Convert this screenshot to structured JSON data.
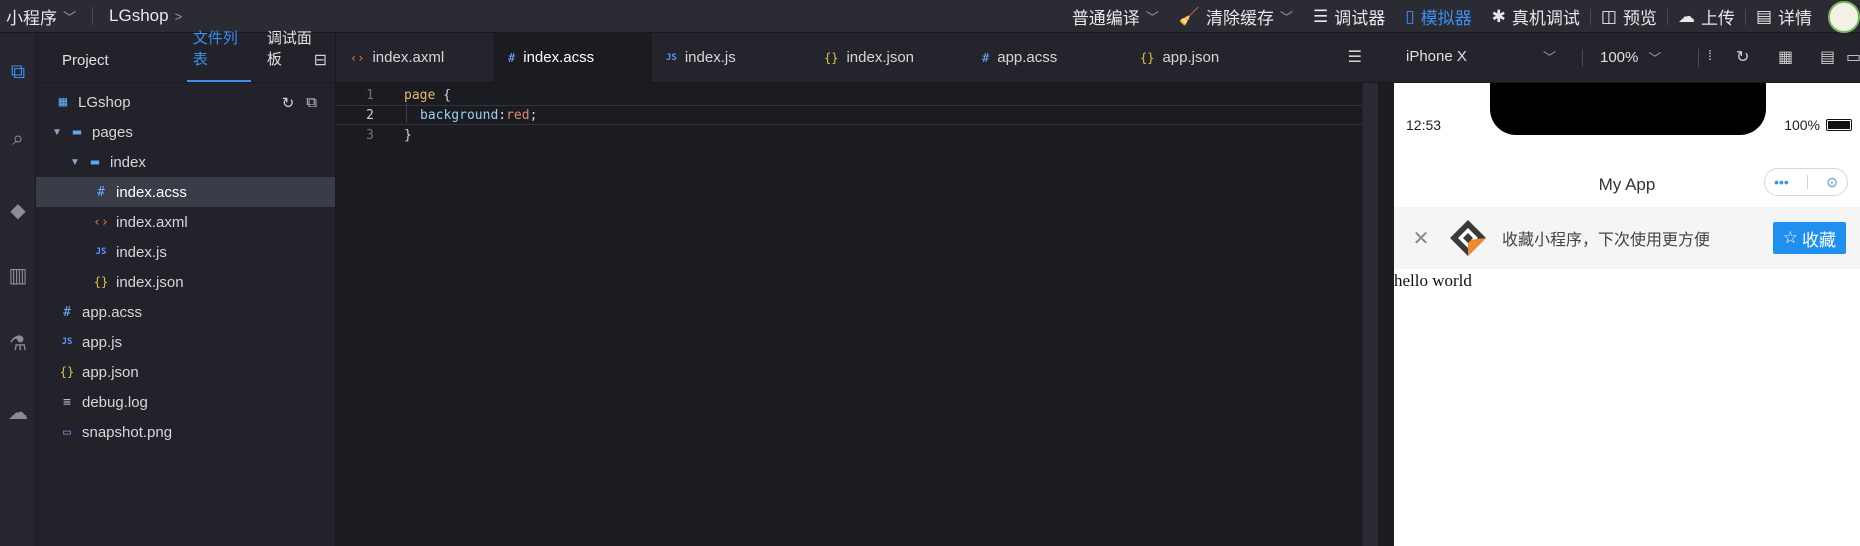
{
  "topbar": {
    "app_name": "小程序",
    "project": "LGshop",
    "compile_mode": "普通编译",
    "clear_cache": "清除缓存",
    "debugger": "调试器",
    "simulator": "模拟器",
    "device_debug": "真机调试",
    "preview": "预览",
    "upload": "上传",
    "details": "详情"
  },
  "explorer": {
    "tabs": [
      "Project",
      "文件列表",
      "调试面板"
    ],
    "root": "LGshop",
    "items": [
      {
        "label": "pages"
      },
      {
        "label": "index"
      },
      {
        "label": "index.acss"
      },
      {
        "label": "index.axml"
      },
      {
        "label": "index.js"
      },
      {
        "label": "index.json"
      },
      {
        "label": "app.acss"
      },
      {
        "label": "app.js"
      },
      {
        "label": "app.json"
      },
      {
        "label": "debug.log"
      },
      {
        "label": "snapshot.png"
      }
    ]
  },
  "editor": {
    "tabs": [
      {
        "label": "index.axml"
      },
      {
        "label": "index.acss"
      },
      {
        "label": "index.js"
      },
      {
        "label": "index.json"
      },
      {
        "label": "app.acss"
      },
      {
        "label": "app.json"
      }
    ],
    "lines": [
      {
        "num": "1",
        "sel": "page",
        "brace": " {"
      },
      {
        "num": "2",
        "prop": "background",
        "colon": ":",
        "val": "red",
        "semi": ";"
      },
      {
        "num": "3",
        "text": "}"
      }
    ]
  },
  "simulator": {
    "device": "iPhone X",
    "zoom": "100%",
    "time": "12:53",
    "battery": "100%",
    "page_title": "My App",
    "fav_text": "收藏小程序，下次使用更方便",
    "fav_button": "收藏",
    "content": "hello world"
  }
}
